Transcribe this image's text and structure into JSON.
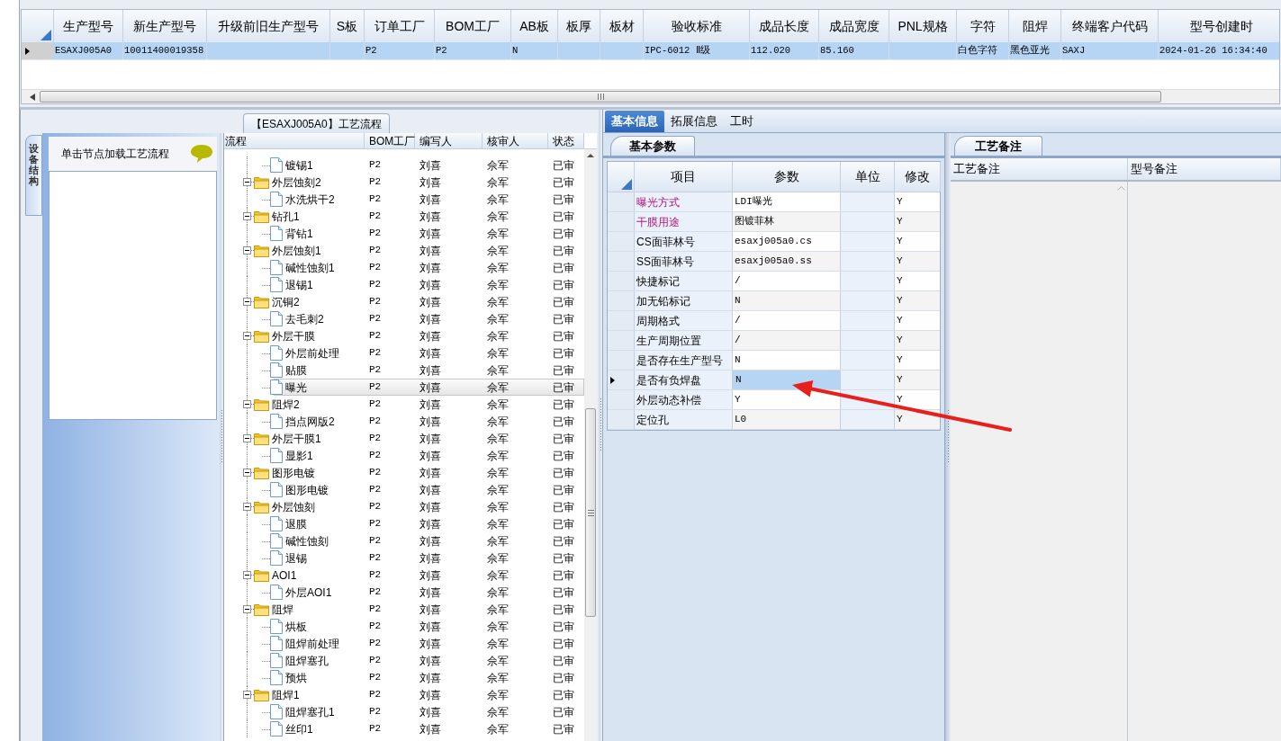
{
  "top_grid": {
    "columns": [
      "生产型号",
      "新生产型号",
      "升级前旧生产型号",
      "S板",
      "订单工厂",
      "BOM工厂",
      "AB板",
      "板厚",
      "板材",
      "验收标准",
      "成品长度",
      "成品宽度",
      "PNL规格",
      "字符",
      "阻焊",
      "终端客户代码",
      "型号创建时"
    ],
    "rows": [
      {
        "selected": true,
        "cells": [
          "ESAXJ005A0",
          "10011400019358",
          null,
          null,
          "P2",
          "P2",
          "N",
          null,
          null,
          "IPC-6012 Ⅱ级",
          "112.020",
          "85.160",
          null,
          "白色字符",
          "黑色亚光",
          "SAXJ",
          "2024-01-26 16:34:40"
        ]
      }
    ]
  },
  "flow_panel": {
    "title": "【ESAXJ005A0】工艺流程",
    "side_tab": "设备结构",
    "hint": "单击节点加载工艺流程",
    "columns": [
      "流程",
      "BOM工厂",
      "编写人",
      "核审人",
      "状态"
    ],
    "tree": [
      {
        "kind": "file",
        "label": "镀锡1",
        "bom": "P2",
        "author": "刘喜",
        "reviewer": "佘军",
        "status": "已审",
        "selected": false
      },
      {
        "kind": "folder",
        "label": "外层蚀刻2",
        "bom": "P2",
        "author": "刘喜",
        "reviewer": "佘军",
        "status": "已审",
        "selected": false,
        "children": [
          {
            "kind": "file",
            "label": "水洗烘干2",
            "bom": "P2",
            "author": "刘喜",
            "reviewer": "佘军",
            "status": "已审",
            "selected": false
          }
        ]
      },
      {
        "kind": "folder",
        "label": "钻孔1",
        "bom": "P2",
        "author": "刘喜",
        "reviewer": "佘军",
        "status": "已审",
        "selected": false,
        "children": [
          {
            "kind": "file",
            "label": "背钻1",
            "bom": "P2",
            "author": "刘喜",
            "reviewer": "佘军",
            "status": "已审",
            "selected": false
          }
        ]
      },
      {
        "kind": "folder",
        "label": "外层蚀刻1",
        "bom": "P2",
        "author": "刘喜",
        "reviewer": "佘军",
        "status": "已审",
        "selected": false,
        "children": [
          {
            "kind": "file",
            "label": "碱性蚀刻1",
            "bom": "P2",
            "author": "刘喜",
            "reviewer": "佘军",
            "status": "已审",
            "selected": false
          },
          {
            "kind": "file",
            "label": "退锡1",
            "bom": "P2",
            "author": "刘喜",
            "reviewer": "佘军",
            "status": "已审",
            "selected": false
          }
        ]
      },
      {
        "kind": "folder",
        "label": "沉铜2",
        "bom": "P2",
        "author": "刘喜",
        "reviewer": "佘军",
        "status": "已审",
        "selected": false,
        "children": [
          {
            "kind": "file",
            "label": "去毛刺2",
            "bom": "P2",
            "author": "刘喜",
            "reviewer": "佘军",
            "status": "已审",
            "selected": false
          }
        ]
      },
      {
        "kind": "folder",
        "label": "外层干膜",
        "bom": "P2",
        "author": "刘喜",
        "reviewer": "佘军",
        "status": "已审",
        "selected": false,
        "children": [
          {
            "kind": "file",
            "label": "外层前处理",
            "bom": "P2",
            "author": "刘喜",
            "reviewer": "佘军",
            "status": "已审",
            "selected": false
          },
          {
            "kind": "file",
            "label": "贴膜",
            "bom": "P2",
            "author": "刘喜",
            "reviewer": "佘军",
            "status": "已审",
            "selected": false
          },
          {
            "kind": "file",
            "label": "曝光",
            "bom": "P2",
            "author": "刘喜",
            "reviewer": "佘军",
            "status": "已审",
            "selected": true
          }
        ]
      },
      {
        "kind": "folder",
        "label": "阻焊2",
        "bom": "P2",
        "author": "刘喜",
        "reviewer": "佘军",
        "status": "已审",
        "selected": false,
        "children": [
          {
            "kind": "file",
            "label": "挡点网版2",
            "bom": "P2",
            "author": "刘喜",
            "reviewer": "佘军",
            "status": "已审",
            "selected": false
          }
        ]
      },
      {
        "kind": "folder",
        "label": "外层干膜1",
        "bom": "P2",
        "author": "刘喜",
        "reviewer": "佘军",
        "status": "已审",
        "selected": false,
        "children": [
          {
            "kind": "file",
            "label": "显影1",
            "bom": "P2",
            "author": "刘喜",
            "reviewer": "佘军",
            "status": "已审",
            "selected": false
          }
        ]
      },
      {
        "kind": "folder",
        "label": "图形电镀",
        "bom": "P2",
        "author": "刘喜",
        "reviewer": "佘军",
        "status": "已审",
        "selected": false,
        "children": [
          {
            "kind": "file",
            "label": "图形电镀",
            "bom": "P2",
            "author": "刘喜",
            "reviewer": "佘军",
            "status": "已审",
            "selected": false
          }
        ]
      },
      {
        "kind": "folder",
        "label": "外层蚀刻",
        "bom": "P2",
        "author": "刘喜",
        "reviewer": "佘军",
        "status": "已审",
        "selected": false,
        "children": [
          {
            "kind": "file",
            "label": "退膜",
            "bom": "P2",
            "author": "刘喜",
            "reviewer": "佘军",
            "status": "已审",
            "selected": false
          },
          {
            "kind": "file",
            "label": "碱性蚀刻",
            "bom": "P2",
            "author": "刘喜",
            "reviewer": "佘军",
            "status": "已审",
            "selected": false
          },
          {
            "kind": "file",
            "label": "退锡",
            "bom": "P2",
            "author": "刘喜",
            "reviewer": "佘军",
            "status": "已审",
            "selected": false
          }
        ]
      },
      {
        "kind": "folder",
        "label": "AOI1",
        "bom": "P2",
        "author": "刘喜",
        "reviewer": "佘军",
        "status": "已审",
        "selected": false,
        "children": [
          {
            "kind": "file",
            "label": "外层AOI1",
            "bom": "P2",
            "author": "刘喜",
            "reviewer": "佘军",
            "status": "已审",
            "selected": false
          }
        ]
      },
      {
        "kind": "folder",
        "label": "阻焊",
        "bom": "P2",
        "author": "刘喜",
        "reviewer": "佘军",
        "status": "已审",
        "selected": false,
        "children": [
          {
            "kind": "file",
            "label": "烘板",
            "bom": "P2",
            "author": "刘喜",
            "reviewer": "佘军",
            "status": "已审",
            "selected": false
          },
          {
            "kind": "file",
            "label": "阻焊前处理",
            "bom": "P2",
            "author": "刘喜",
            "reviewer": "佘军",
            "status": "已审",
            "selected": false
          },
          {
            "kind": "file",
            "label": "阻焊塞孔",
            "bom": "P2",
            "author": "刘喜",
            "reviewer": "佘军",
            "status": "已审",
            "selected": false
          },
          {
            "kind": "file",
            "label": "预烘",
            "bom": "P2",
            "author": "刘喜",
            "reviewer": "佘军",
            "status": "已审",
            "selected": false
          }
        ]
      },
      {
        "kind": "folder",
        "label": "阻焊1",
        "bom": "P2",
        "author": "刘喜",
        "reviewer": "佘军",
        "status": "已审",
        "selected": false,
        "children": [
          {
            "kind": "file",
            "label": "阻焊塞孔1",
            "bom": "P2",
            "author": "刘喜",
            "reviewer": "佘军",
            "status": "已审",
            "selected": false
          },
          {
            "kind": "file",
            "label": "丝印1",
            "bom": "P2",
            "author": "刘喜",
            "reviewer": "佘军",
            "status": "已审",
            "selected": false
          }
        ]
      }
    ]
  },
  "tabs": [
    {
      "label": "基本信息",
      "selected": true
    },
    {
      "label": "拓展信息",
      "selected": false
    },
    {
      "label": "工时",
      "selected": false
    }
  ],
  "basic_params": {
    "tab": "基本参数",
    "columns": [
      "项目",
      "参数",
      "单位",
      "修改"
    ],
    "rows": [
      {
        "item": "曝光方式",
        "value": "LDI曝光",
        "modify": "Y",
        "emphasized": true,
        "selected": false
      },
      {
        "item": "干膜用途",
        "value": "图镀菲林",
        "modify": "Y",
        "emphasized": true,
        "selected": false
      },
      {
        "item": "CS面菲林号",
        "value": "esaxj005a0.cs",
        "modify": "Y",
        "emphasized": false,
        "selected": false
      },
      {
        "item": "SS面菲林号",
        "value": "esaxj005a0.ss",
        "modify": "Y",
        "emphasized": false,
        "selected": false
      },
      {
        "item": "快捷标记",
        "value": "/",
        "modify": "Y",
        "emphasized": false,
        "selected": false
      },
      {
        "item": "加无铅标记",
        "value": "N",
        "modify": "Y",
        "emphasized": false,
        "selected": false
      },
      {
        "item": "周期格式",
        "value": "/",
        "modify": "Y",
        "emphasized": false,
        "selected": false
      },
      {
        "item": "生产周期位置",
        "value": "/",
        "modify": "Y",
        "emphasized": false,
        "selected": false
      },
      {
        "item": "是否存在生产型号",
        "value": "N",
        "modify": "Y",
        "emphasized": false,
        "selected": false
      },
      {
        "item": "是否有负焊盘",
        "value": "N",
        "modify": "Y",
        "emphasized": false,
        "selected": true
      },
      {
        "item": "外层动态补偿",
        "value": "Y",
        "modify": "Y",
        "emphasized": false,
        "selected": false
      },
      {
        "item": "定位孔",
        "value": "L0",
        "modify": "Y",
        "emphasized": false,
        "selected": false
      }
    ]
  },
  "notes": {
    "tab": "工艺备注",
    "columns": [
      "工艺备注",
      "型号备注"
    ]
  }
}
